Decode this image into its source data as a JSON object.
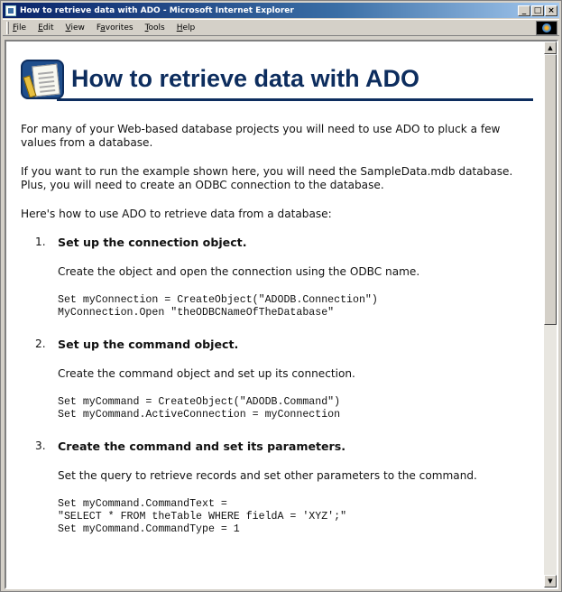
{
  "window": {
    "title": "How to retrieve data with ADO - Microsoft Internet Explorer",
    "buttons": {
      "minimize": "_",
      "maximize": "□",
      "close": "×"
    }
  },
  "menu": [
    {
      "accel": "F",
      "rest": "ile"
    },
    {
      "accel": "E",
      "rest": "dit"
    },
    {
      "accel": "V",
      "rest": "iew"
    },
    {
      "pre": "F",
      "accel": "a",
      "rest": "vorites"
    },
    {
      "accel": "T",
      "rest": "ools"
    },
    {
      "accel": "H",
      "rest": "elp"
    }
  ],
  "page": {
    "title": "How to retrieve data with ADO",
    "intro": "For many of your Web-based database projects you will need to use ADO to pluck a few values from a database.",
    "requirements": "If you want to run the example shown here, you will need the SampleData.mdb database. Plus, you will need to create an ODBC connection to the database.",
    "lead": "Here's how to use ADO to retrieve data from a database:",
    "steps": [
      {
        "num": "1.",
        "heading": "Set up the connection object.",
        "description": "Create the object and open the connection using the ODBC name.",
        "code": "Set myConnection = CreateObject(\"ADODB.Connection\")\nMyConnection.Open \"theODBCNameOfTheDatabase\""
      },
      {
        "num": "2.",
        "heading": "Set up the command object.",
        "description": "Create the command object and set up its connection.",
        "code": "Set myCommand = CreateObject(\"ADODB.Command\")\nSet myCommand.ActiveConnection = myConnection"
      },
      {
        "num": "3.",
        "heading": "Create the command and set its parameters.",
        "description": "Set the query to retrieve records and set other parameters to the command.",
        "code": "Set myCommand.CommandText =\n\"SELECT * FROM theTable WHERE fieldA = 'XYZ';\"\nSet myCommand.CommandType = 1"
      }
    ]
  },
  "scrollbar": {
    "up": "▲",
    "down": "▼"
  },
  "icons": {
    "window": "ie-page-icon",
    "brand": "ie-throbber-icon",
    "header": "document-pencil-icon"
  }
}
